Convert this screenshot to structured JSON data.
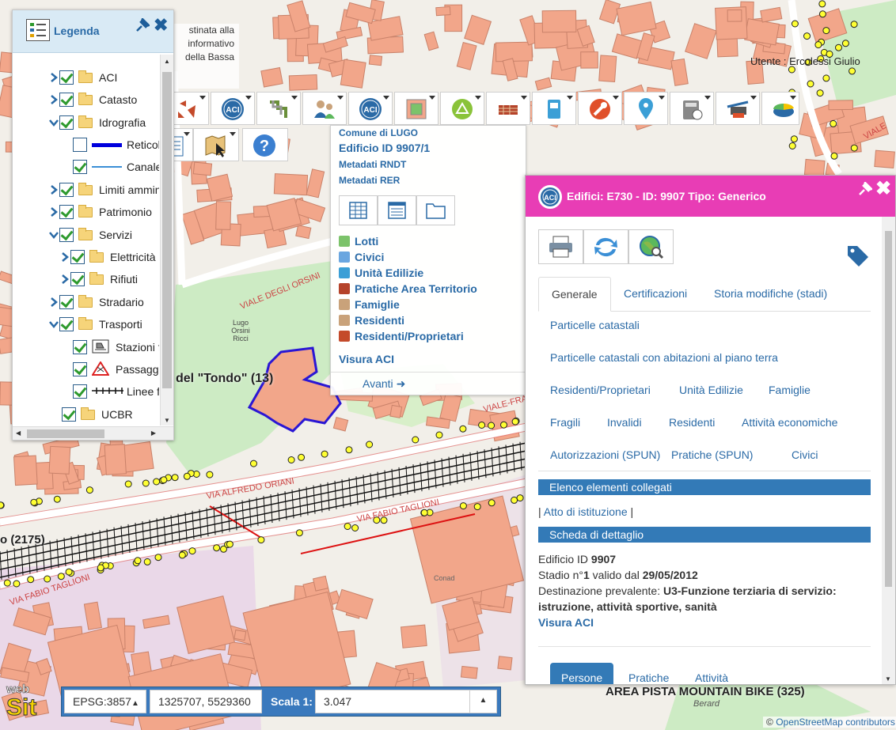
{
  "legend": {
    "title": "Legenda",
    "items": [
      {
        "label": "ACI",
        "checked": true,
        "expanded": false,
        "level": 0,
        "kind": "folder"
      },
      {
        "label": "Catasto",
        "checked": true,
        "expanded": false,
        "level": 0,
        "kind": "folder"
      },
      {
        "label": "Idrografia",
        "checked": true,
        "expanded": true,
        "level": 0,
        "kind": "folder"
      },
      {
        "label": "Reticolo",
        "checked": false,
        "level": 1,
        "kind": "line-thick"
      },
      {
        "label": "Canale E",
        "checked": true,
        "level": 1,
        "kind": "line-thin"
      },
      {
        "label": "Limiti amminist",
        "checked": true,
        "expanded": false,
        "level": 0,
        "kind": "folder"
      },
      {
        "label": "Patrimonio",
        "checked": true,
        "expanded": false,
        "level": 0,
        "kind": "folder"
      },
      {
        "label": "Servizi",
        "checked": true,
        "expanded": true,
        "level": 0,
        "kind": "folder"
      },
      {
        "label": "Elettricità",
        "checked": true,
        "expanded": false,
        "level": 1,
        "kind": "folder"
      },
      {
        "label": "Rifiuti",
        "checked": true,
        "expanded": false,
        "level": 1,
        "kind": "folder"
      },
      {
        "label": "Stradario",
        "checked": true,
        "expanded": false,
        "level": 0,
        "kind": "folder"
      },
      {
        "label": "Trasporti",
        "checked": true,
        "expanded": true,
        "level": 0,
        "kind": "folder"
      },
      {
        "label": "Stazioni f",
        "checked": true,
        "level": 1,
        "kind": "station-icon"
      },
      {
        "label": "Passagg",
        "checked": true,
        "level": 1,
        "kind": "warning-icon"
      },
      {
        "label": "Linee fer",
        "checked": true,
        "level": 1,
        "kind": "rail-line"
      },
      {
        "label": "UCBR",
        "checked": true,
        "level": 0,
        "kind": "folder"
      }
    ]
  },
  "map": {
    "user": "Utente : Ercolessi Giulio",
    "tooltip_lines": [
      "stinata alla",
      "informativo",
      "della Bassa"
    ],
    "labels": {
      "tondo": "del \"Tondo\" (13)",
      "po": "o (2175)",
      "pista": "AREA PISTA MOUNTAIN BIKE (325)",
      "lugo_orsini": "Lugo Orsini Ricci",
      "berardi": "Berard",
      "conad": "Conad",
      "attribution_prefix": "©",
      "attribution": "OpenStreetMap contributors",
      "streets": [
        "VIALE DEGLI ORSINI",
        "VIA ALFREDO ORIANI",
        "VIA FABIO TAGLIONI",
        "VIA FABIO TAGLIONI",
        "VIALE-FRA",
        "VIALE"
      ]
    }
  },
  "toolbar": {
    "icons": [
      "organization-icon",
      "aci-icon",
      "network-icon",
      "users-icon",
      "aci-icon",
      "building-layers-icon",
      "area-icon",
      "building-icon",
      "door-icon",
      "tools-icon",
      "location-pin-icon",
      "calculator-icon",
      "printer-area-icon",
      "pie-chart-icon"
    ],
    "row2": [
      "document-icon",
      "map-select-icon",
      "help-icon"
    ]
  },
  "info_menu": {
    "comune": "Comune di LUGO",
    "edificio": "Edificio ID 9907/1",
    "meta1": "Metadati RNDT",
    "meta2": "Metadati RER",
    "links": [
      "Lotti",
      "Civici",
      "Unità Edilizie",
      "Pratiche Area Territorio",
      "Famiglie",
      "Residenti",
      "Residenti/Proprietari"
    ],
    "visura": "Visura ACI",
    "next": "Avanti",
    "next_arrow": "➜"
  },
  "detail": {
    "title": "Edifici: E730 - ID: 9907 Tipo: Generico",
    "tabs": [
      "Generale",
      "Certificazioni",
      "Storia modifiche (stadi)"
    ],
    "links_row1": [
      "Particelle catastali"
    ],
    "links_row2": [
      "Particelle catastali con abitazioni al piano terra"
    ],
    "links_row3": [
      "Residenti/Proprietari",
      "Unità Edilizie",
      "Famiglie"
    ],
    "links_row4": [
      "Fragili",
      "Invalidi",
      "Residenti",
      "Attività economiche"
    ],
    "links_row5": [
      "Autorizzazioni (SPUN)",
      "Pratiche (SPUN)",
      "Civici"
    ],
    "sec_linked": "Elenco elementi collegati",
    "linked_prefix": "|",
    "linked_item": "Atto di istituzione",
    "linked_suffix": "|",
    "sec_detail": "Scheda di dettaglio",
    "edificio_label": "Edificio ID",
    "edificio_value": "9907",
    "stadio_label": "Stadio n°",
    "stadio_num": "1",
    "stadio_mid": "valido dal",
    "stadio_date": "29/05/2012",
    "dest_label": "Destinazione prevalente:",
    "dest_value1": "U3-Funzione terziaria di servizio:",
    "dest_value2": "istruzione, attività sportive, sanità",
    "visura": "Visura ACI",
    "bottom_tabs": [
      "Persone",
      "Pratiche",
      "Attività"
    ]
  },
  "bottombar": {
    "epsg": "EPSG:3857",
    "coords": "1325707, 5529360",
    "scale_label": "Scala 1:",
    "scale_value": "3.047"
  },
  "logo_text": [
    "web",
    "Sit"
  ],
  "colors": {
    "building": "#f2a68a",
    "road": "#ffffff",
    "park": "#cdebc4",
    "rail": "#111111",
    "highlight": "#2a16d4",
    "detail_header": "#e83db5",
    "accent": "#337ab7"
  }
}
